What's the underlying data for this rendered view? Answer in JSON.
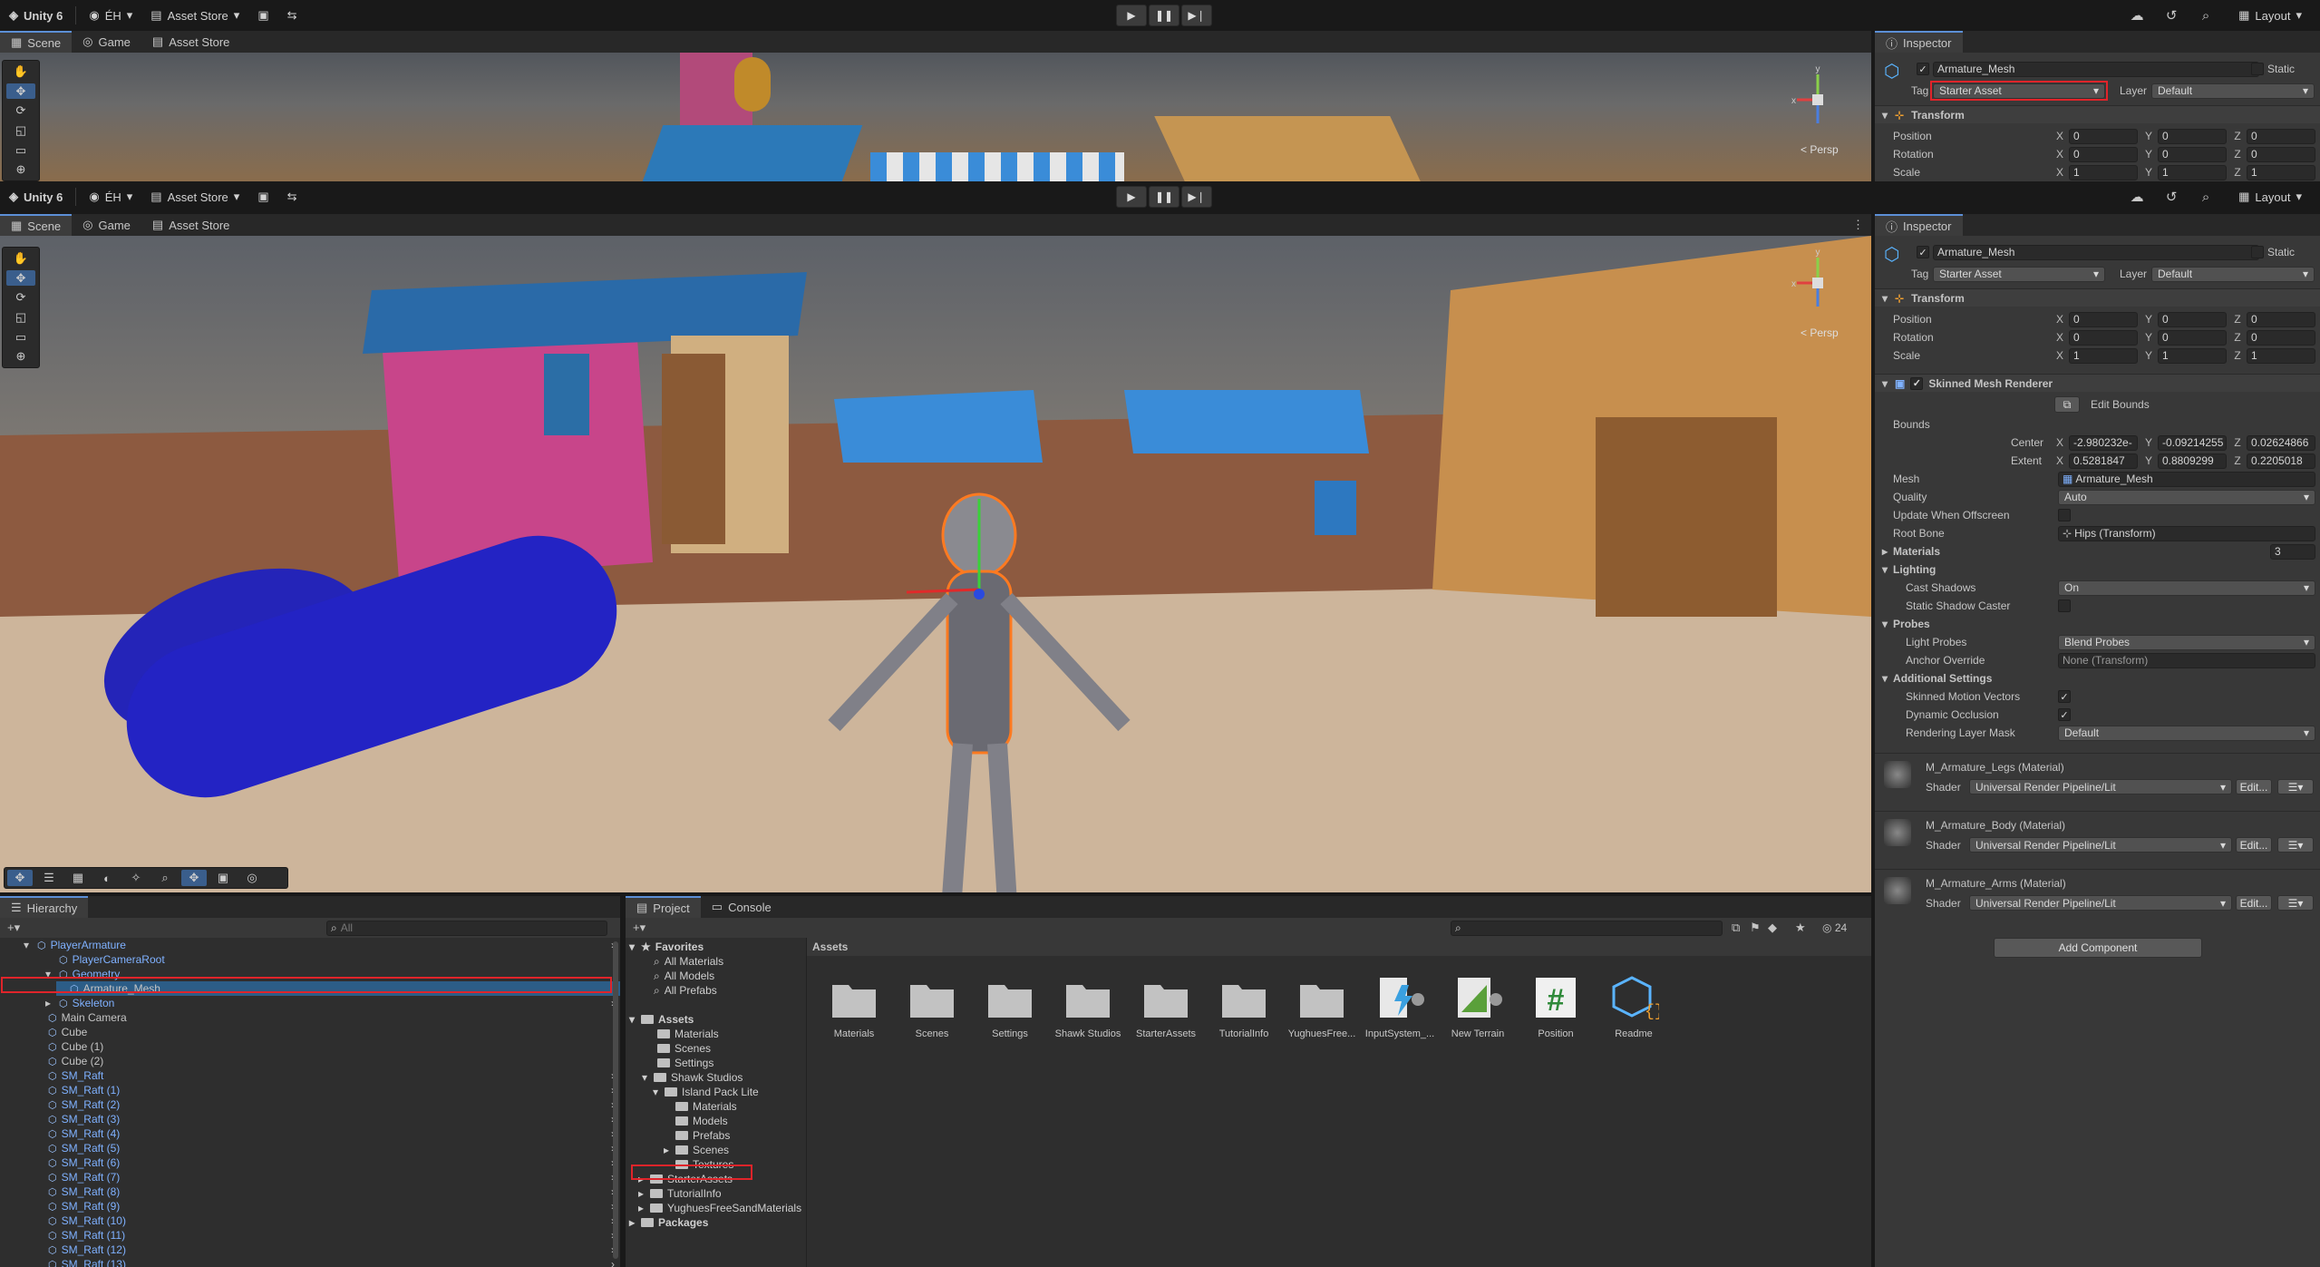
{
  "toolbar": {
    "app": "Unity 6",
    "account": "ÉH",
    "asset_store": "Asset Store",
    "layout": "Layout"
  },
  "scene_tabs": {
    "scene": "Scene",
    "game": "Game",
    "asset_store": "Asset Store"
  },
  "persp": "< Persp",
  "inspector": {
    "tab": "Inspector",
    "object_name": "Armature_Mesh",
    "static": "Static",
    "tag_label": "Tag",
    "tag_value": "Starter Asset",
    "layer_label": "Layer",
    "layer_value": "Default",
    "transform": {
      "title": "Transform",
      "position_label": "Position",
      "rotation_label": "Rotation",
      "scale_label": "Scale",
      "position": [
        "0",
        "0",
        "0"
      ],
      "rotation": [
        "0",
        "0",
        "0"
      ],
      "scale": [
        "1",
        "1",
        "1"
      ]
    },
    "smr": {
      "title": "Skinned Mesh Renderer",
      "edit_bounds": "Edit Bounds",
      "bounds": "Bounds",
      "center": "Center",
      "center_vals": [
        "-2.980232e-",
        "-0.09214255",
        "0.02624866"
      ],
      "extent": "Extent",
      "extent_vals": [
        "0.5281847",
        "0.8809299",
        "0.2205018"
      ],
      "mesh_label": "Mesh",
      "mesh_value": "Armature_Mesh",
      "quality_label": "Quality",
      "quality_value": "Auto",
      "update_offscreen": "Update When Offscreen",
      "root_bone_label": "Root Bone",
      "root_bone_value": "Hips (Transform)",
      "materials_label": "Materials",
      "materials_count": "3",
      "lighting": "Lighting",
      "cast_shadows_label": "Cast Shadows",
      "cast_shadows_value": "On",
      "static_shadow": "Static Shadow Caster",
      "probes": "Probes",
      "light_probes_label": "Light Probes",
      "light_probes_value": "Blend Probes",
      "anchor_label": "Anchor Override",
      "anchor_value": "None (Transform)",
      "additional": "Additional Settings",
      "skinned_motion": "Skinned Motion Vectors",
      "dynamic_occlusion": "Dynamic Occlusion",
      "rendering_layer_label": "Rendering Layer Mask",
      "rendering_layer_value": "Default"
    },
    "materials": [
      {
        "name": "M_Armature_Legs (Material)",
        "shader": "Universal Render Pipeline/Lit"
      },
      {
        "name": "M_Armature_Body (Material)",
        "shader": "Universal Render Pipeline/Lit"
      },
      {
        "name": "M_Armature_Arms (Material)",
        "shader": "Universal Render Pipeline/Lit"
      }
    ],
    "shader_label": "Shader",
    "edit": "Edit...",
    "add_component": "Add Component"
  },
  "hierarchy": {
    "tab": "Hierarchy",
    "search_placeholder": "All",
    "items": [
      "PlayerArmature",
      "PlayerCameraRoot",
      "Geometry",
      "Armature_Mesh",
      "Skeleton",
      "Main Camera",
      "Cube",
      "Cube (1)",
      "Cube (2)",
      "SM_Raft",
      "SM_Raft (1)",
      "SM_Raft (2)",
      "SM_Raft (3)",
      "SM_Raft (4)",
      "SM_Raft (5)",
      "SM_Raft (6)",
      "SM_Raft (7)",
      "SM_Raft (8)",
      "SM_Raft (9)",
      "SM_Raft (10)",
      "SM_Raft (11)",
      "SM_Raft (12)",
      "SM_Raft (13)"
    ]
  },
  "project": {
    "tab": "Project",
    "console_tab": "Console",
    "count": "24",
    "favorites": "Favorites",
    "fav_items": [
      "All Materials",
      "All Models",
      "All Prefabs"
    ],
    "assets": "Assets",
    "tree": [
      "Materials",
      "Scenes",
      "Settings",
      "Shawk Studios",
      "Island Pack Lite",
      "Materials",
      "Models",
      "Prefabs",
      "Scenes",
      "Textures",
      "StarterAssets",
      "TutorialInfo",
      "YughuesFreeSandMaterials"
    ],
    "packages": "Packages",
    "breadcrumb": "Assets",
    "grid": [
      "Materials",
      "Scenes",
      "Settings",
      "Shawk Studios",
      "StarterAssets",
      "TutorialInfo",
      "YughuesFree...",
      "InputSystem_...",
      "New Terrain",
      "Position",
      "Readme"
    ]
  }
}
